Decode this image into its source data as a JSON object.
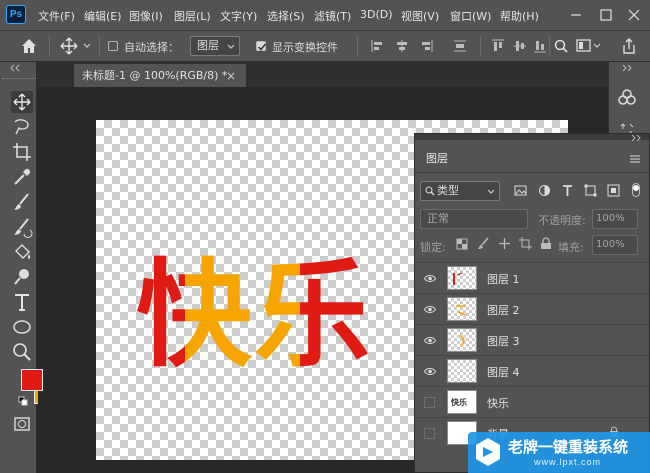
{
  "app": {
    "logo": "Ps"
  },
  "menu": [
    "文件(F)",
    "编辑(E)",
    "图像(I)",
    "图层(L)",
    "文字(Y)",
    "选择(S)",
    "滤镜(T)",
    "3D(D)",
    "视图(V)",
    "窗口(W)",
    "帮助(H)"
  ],
  "options": {
    "auto_select_label": "自动选择：",
    "auto_select_value": "图层",
    "show_transform_label": "显示变换控件"
  },
  "document": {
    "tab_title": "未标题-1 @ 100%(RGB/8) *",
    "close": "×"
  },
  "artwork": {
    "char1": "快",
    "char2": "乐",
    "colors": {
      "red": "#e01b14",
      "orange": "#f6a500"
    }
  },
  "tools": {
    "foreground_color": "#e01b14",
    "background_color": "#f6a500"
  },
  "layers_panel": {
    "title": "图层",
    "filter_kind": "类型",
    "blend_mode": "正常",
    "opacity_label": "不透明度:",
    "opacity_value": "100%",
    "lock_label": "锁定:",
    "fill_label": "填充:",
    "fill_value": "100%",
    "layers": [
      {
        "name": "图层 1",
        "visible": true
      },
      {
        "name": "图层 2",
        "visible": true
      },
      {
        "name": "图层 3",
        "visible": true
      },
      {
        "name": "图层 4",
        "visible": true
      },
      {
        "name": "快乐",
        "visible": false,
        "thumb_text": "快乐"
      },
      {
        "name": "背景",
        "visible": false
      }
    ]
  },
  "watermark": {
    "text": "老牌一键重装系统",
    "url": "www.lpxt.com"
  }
}
